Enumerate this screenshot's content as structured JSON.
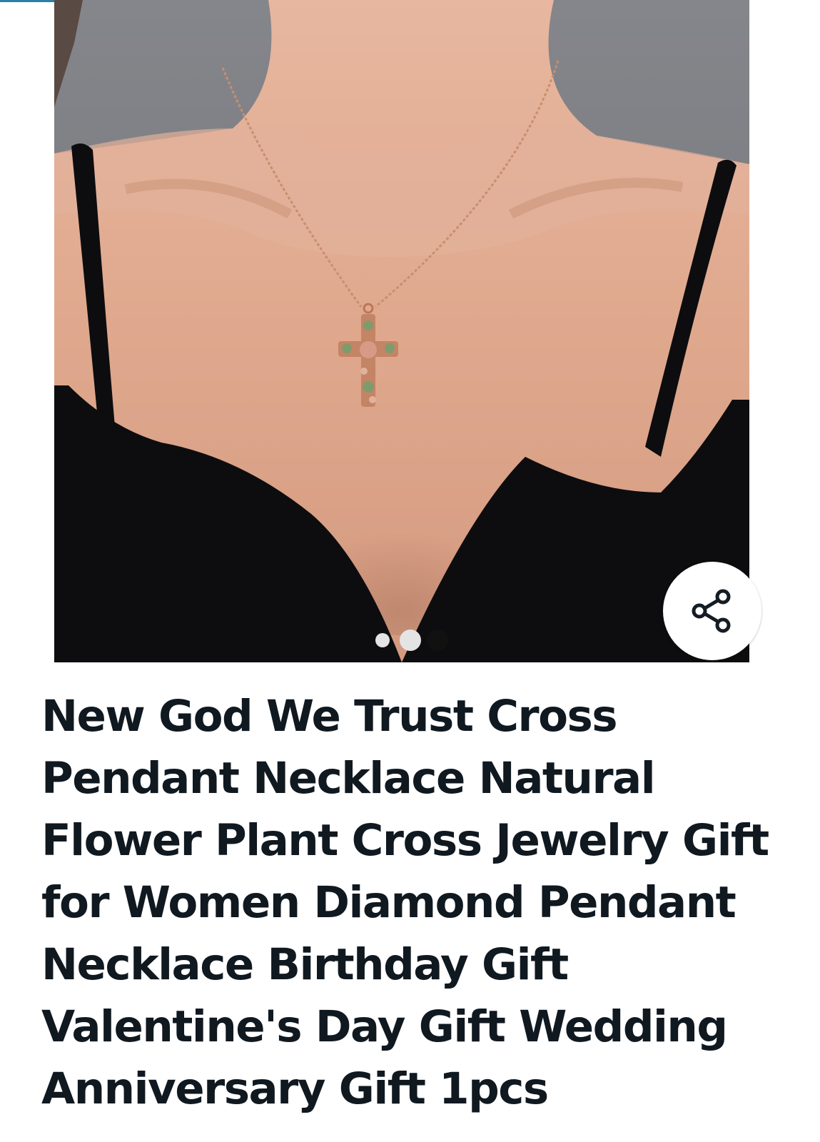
{
  "page_indicator": {
    "total": 3,
    "active_index": 2
  },
  "share": {
    "icon": "share-icon"
  },
  "product": {
    "title": "New God We Trust Cross Pendant Necklace Natural Flower Plant Cross Jewelry Gift for Women Diamond Pendant Necklace Birthday Gift Valentine's Day Gift Wedding Anniversary Gift 1pcs"
  },
  "colors": {
    "background": "#ffffff",
    "title_text": "#101820",
    "photo_backdrop": "#7a7b80",
    "top_progress": "#2a7fa8"
  }
}
